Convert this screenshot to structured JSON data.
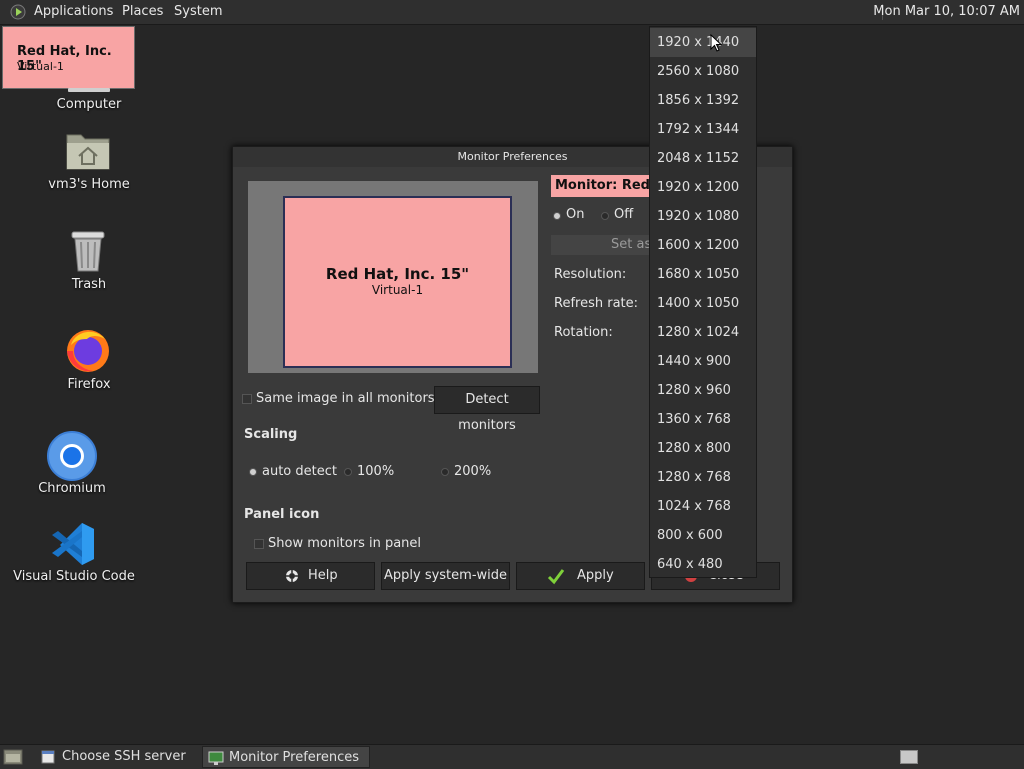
{
  "top_panel": {
    "menus": [
      "Applications",
      "Places",
      "System"
    ],
    "clock": "Mon Mar 10, 10:07 AM"
  },
  "applet_popup": {
    "monitor_name": "Red Hat, Inc. 15\"",
    "connector": "Virtual-1"
  },
  "desktop_icons": [
    {
      "label": "Computer",
      "icon": "computer-icon"
    },
    {
      "label": "vm3's Home",
      "icon": "home-folder-icon"
    },
    {
      "label": "Trash",
      "icon": "trash-icon"
    },
    {
      "label": "Firefox",
      "icon": "firefox-icon"
    },
    {
      "label": "Chromium",
      "icon": "chromium-icon"
    },
    {
      "label": "Visual Studio Code",
      "icon": "vscode-icon"
    }
  ],
  "dialog": {
    "title": "Monitor Preferences",
    "preview": {
      "monitor_name": "Red Hat, Inc. 15\"",
      "connector": "Virtual-1"
    },
    "monitor_header": "Monitor: Red H",
    "power": {
      "on_label": "On",
      "off_label": "Off",
      "selected": "On"
    },
    "set_as_label": "Set as",
    "resolution_label": "Resolution:",
    "refresh_label": "Refresh rate:",
    "rotation_label": "Rotation:",
    "same_image_label": "Same image in all monitors",
    "detect_label": "Detect monitors",
    "scaling_heading": "Scaling",
    "scaling_options": [
      "auto detect",
      "100%",
      "200%"
    ],
    "scaling_selected": "auto detect",
    "panel_icon_heading": "Panel icon",
    "show_monitors_label": "Show monitors in panel",
    "buttons": {
      "help": "Help",
      "apply_system_wide": "Apply system-wide",
      "apply": "Apply",
      "close": "Close"
    }
  },
  "resolution_dropdown": {
    "items": [
      "1920 x 1440",
      "2560 x 1080",
      "1856 x 1392",
      "1792 x 1344",
      "2048 x 1152",
      "1920 x 1200",
      "1920 x 1080",
      "1600 x 1200",
      "1680 x 1050",
      "1400 x 1050",
      "1280 x 1024",
      "1440 x 900",
      "1280 x 960",
      "1360 x 768",
      "1280 x 800",
      "1280 x 768",
      "1024 x 768",
      "800 x 600",
      "640 x 480"
    ],
    "highlighted": "1920 x 1440"
  },
  "bottom_panel": {
    "tasks": [
      "Choose SSH server",
      "Monitor Preferences"
    ]
  },
  "colors": {
    "monitor_pink": "#f8a4a4",
    "panel_bg": "#2f2f2f",
    "desktop_bg": "#262626"
  }
}
